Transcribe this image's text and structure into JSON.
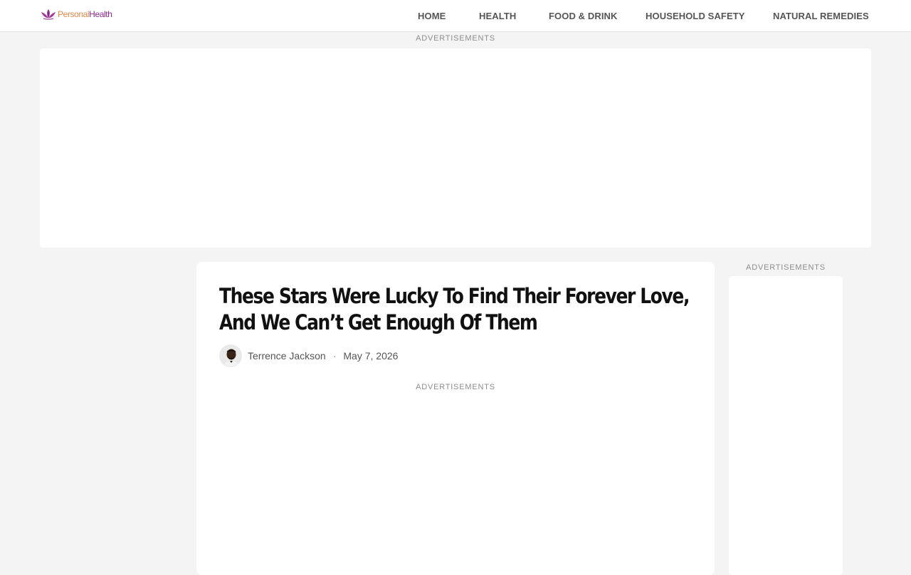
{
  "header": {
    "logo": {
      "text_part1": "Personal",
      "text_part2": "Health",
      "icon": "lotus-icon",
      "colors": {
        "part1": "#e0884a",
        "part2": "#8a2a8c"
      }
    },
    "nav": [
      {
        "label": "HOME"
      },
      {
        "label": "HEALTH"
      },
      {
        "label": "FOOD & DRINK"
      },
      {
        "label": "HOUSEHOLD SAFETY"
      },
      {
        "label": "NATURAL REMEDIES"
      }
    ]
  },
  "ads": {
    "top_label": "ADVERTISEMENTS",
    "mid_label": "ADVERTISEMENTS",
    "side_label": "ADVERTISEMENTS"
  },
  "article": {
    "title": "These Stars Were Lucky To Find Their Forever Love, And We Can’t Get Enough Of Them",
    "author": "Terrence Jackson",
    "separator": "·",
    "date": "May 7, 2026"
  },
  "colors": {
    "page_background": "#f4f4f4",
    "card_background": "#ffffff",
    "nav_text": "#555555",
    "title_text": "#111111"
  }
}
